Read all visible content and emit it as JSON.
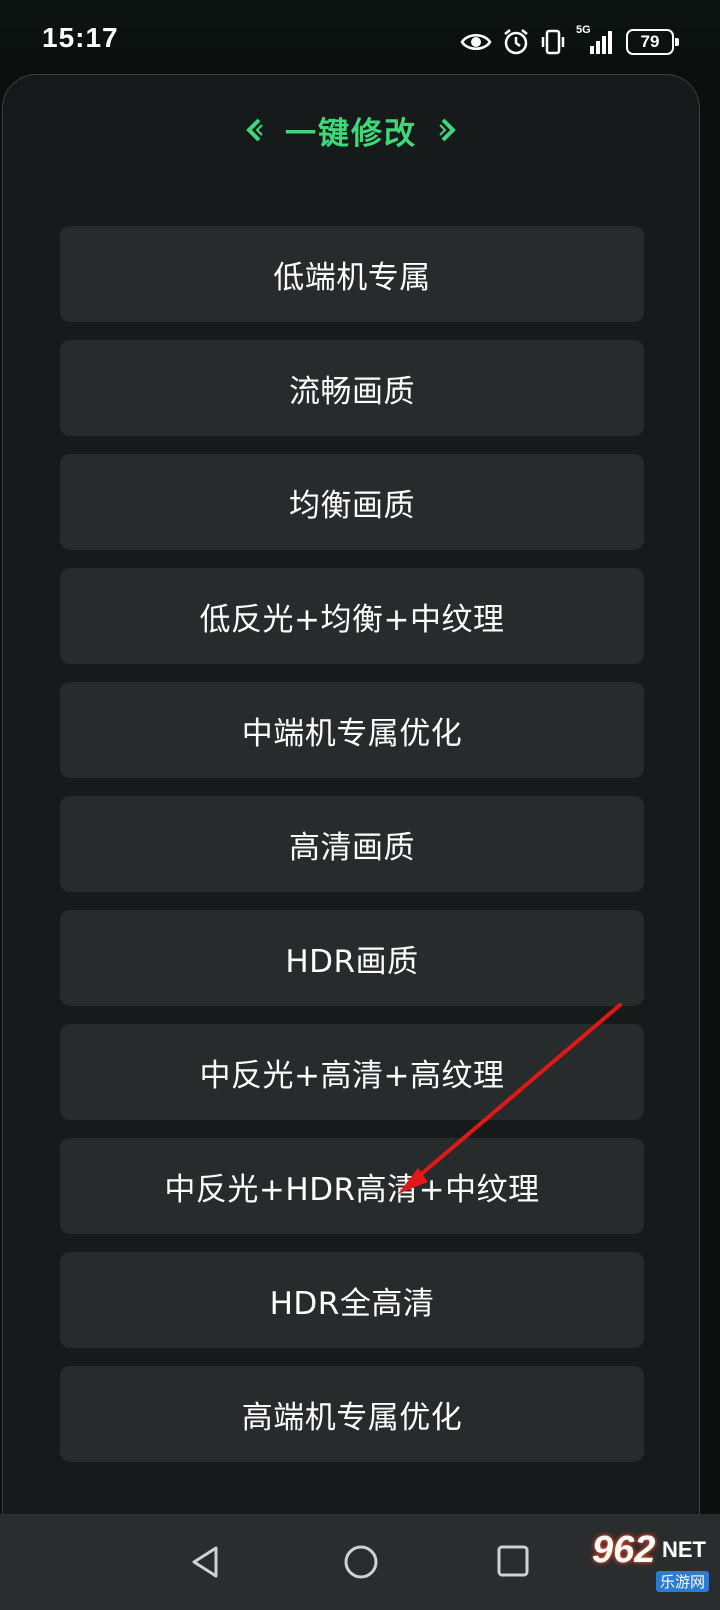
{
  "status_bar": {
    "time": "15:17",
    "network": "5G",
    "battery": "79",
    "icons": [
      "eye-icon",
      "alarm-icon",
      "vibrate-icon",
      "signal-icon",
      "battery-icon"
    ]
  },
  "panel": {
    "title": "一键修改",
    "title_color": "#3ed87a",
    "options": [
      "低端机专属",
      "流畅画质",
      "均衡画质",
      "低反光+均衡+中纹理",
      "中端机专属优化",
      "高清画质",
      "HDR画质",
      "中反光+高清+高纹理",
      "中反光+HDR高清+中纹理",
      "HDR全高清",
      "高端机专属优化"
    ]
  },
  "nav_bar": {
    "icons": [
      "back-icon",
      "home-icon",
      "recents-icon"
    ]
  },
  "watermark": {
    "number": "962",
    "suffix": "NET",
    "sub": "乐游网"
  },
  "annotation": {
    "arrow_color": "#e01818"
  }
}
